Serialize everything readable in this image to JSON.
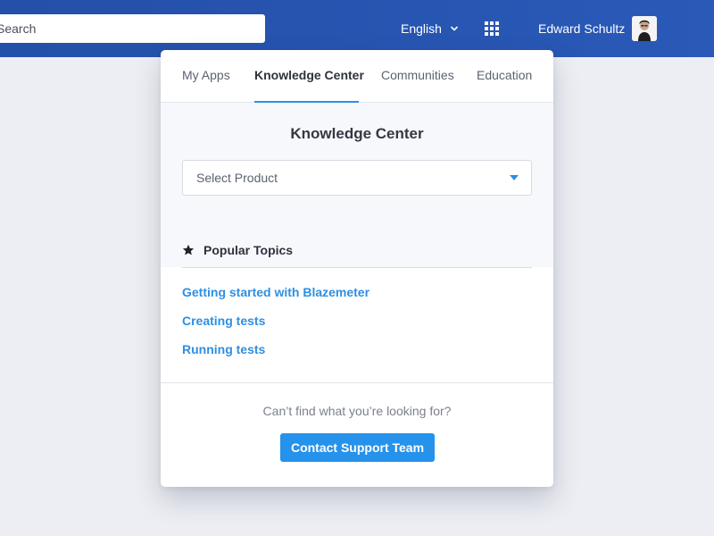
{
  "header": {
    "search_placeholder": "Search",
    "language": "English",
    "user_name": "Edward Schultz",
    "accent_color": "#2350a8"
  },
  "panel": {
    "tabs": [
      {
        "label": "My Apps",
        "active": false
      },
      {
        "label": "Knowledge Center",
        "active": true
      },
      {
        "label": "Communities",
        "active": false
      },
      {
        "label": "Education",
        "active": false
      }
    ],
    "knowledge_center": {
      "title": "Knowledge Center",
      "select_placeholder": "Select Product"
    },
    "popular_topics": {
      "heading": "Popular Topics",
      "icon": "star-icon",
      "links": [
        "Getting started with Blazemeter",
        "Creating tests",
        "Running tests"
      ],
      "link_color": "#2e8fe2"
    },
    "footer": {
      "help_text": "Can’t find what you’re looking for?",
      "contact_button": "Contact Support Team",
      "button_color": "#2592ec"
    }
  }
}
